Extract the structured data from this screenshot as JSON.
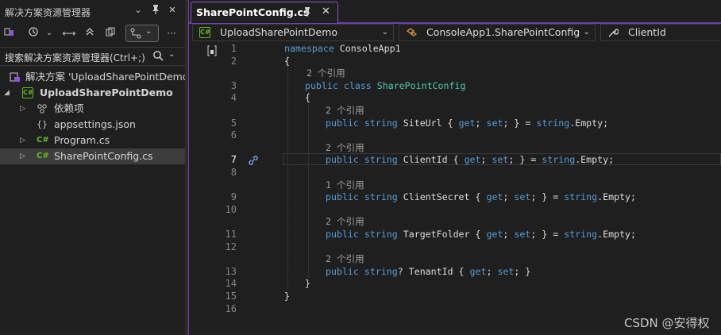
{
  "solution_explorer": {
    "title": "解决方案资源管理器",
    "search_placeholder": "搜索解决方案资源管理器(Ctrl+;)",
    "tree": {
      "solution": "解决方案 'UploadSharePointDemo'",
      "project": "UploadSharePointDemo",
      "dependencies": "依赖项",
      "appsettings": "appsettings.json",
      "program": "Program.cs",
      "sharepointconfig": "SharePointConfig.cs",
      "cs_badge": "C#"
    }
  },
  "editor": {
    "tab_label": "SharePointConfig.cs",
    "nav": {
      "project": "UploadSharePointDemo",
      "type": "ConsoleApp1.SharePointConfig",
      "member": "ClientId",
      "project_badge": "C#"
    },
    "line_numbers": [
      "1",
      "2",
      "3",
      "4",
      "5",
      "6",
      "7",
      "8",
      "9",
      "10",
      "11",
      "12",
      "13",
      "14",
      "15",
      "16"
    ],
    "current_line": "7",
    "lens": {
      "class_refs": "2 个引用",
      "siteurl_refs": "2 个引用",
      "clientid_refs": "2 个引用",
      "clientsecret_refs": "1 个引用",
      "targetfolder_refs": "2 个引用",
      "tenantid_refs": "2 个引用"
    },
    "code": {
      "kw_namespace": "namespace",
      "namespace_name": " ConsoleApp1",
      "brace_open": "{",
      "brace_close": "}",
      "kw_public": "public",
      "kw_class": "class",
      "class_name": "SharePointConfig",
      "kw_string": "string",
      "kw_get": "get",
      "kw_set": "set",
      "empty_suffix": ".Empty;",
      "siteurl": "SiteUrl",
      "clientid": "ClientId",
      "clientsecret": "ClientSecret",
      "targetfolder": "TargetFolder",
      "tenantid": "TenantId"
    }
  },
  "watermark": "CSDN @安得权",
  "colors": {
    "keyword": "#569cd6",
    "type": "#4ec9b0",
    "accent": "#6d3fb0",
    "text": "#dcdcdc"
  }
}
